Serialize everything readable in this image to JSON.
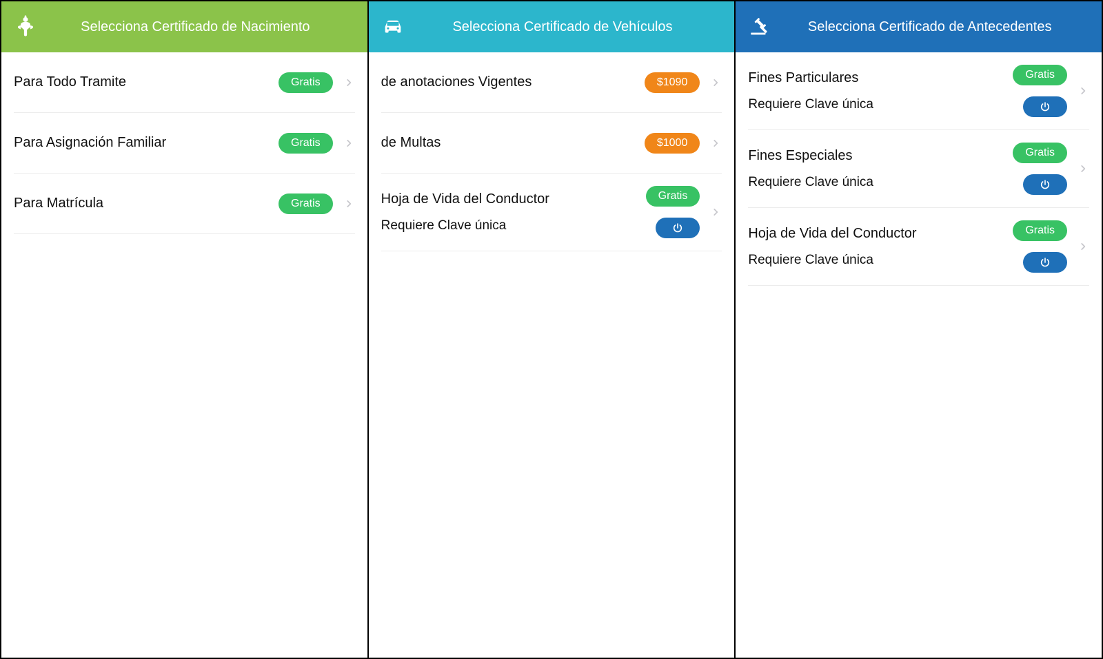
{
  "icons": {
    "baby": "baby-icon",
    "car": "car-icon",
    "gavel": "gavel-icon",
    "power": "power-icon",
    "chevron": "chevron-right-icon"
  },
  "colors": {
    "header_green": "#8BC34A",
    "header_cyan": "#2CB6CC",
    "header_blue": "#1F70B8",
    "pill_green": "#38C264",
    "pill_orange": "#F08619",
    "pill_blue": "#1F70B8"
  },
  "panels": [
    {
      "id": "nacimiento",
      "title": "Selecciona Certificado de Nacimiento",
      "items": [
        {
          "title": "Para Todo Tramite",
          "badge": "Gratis",
          "badge_style": "green"
        },
        {
          "title": "Para Asignación Familiar",
          "badge": "Gratis",
          "badge_style": "green"
        },
        {
          "title": "Para Matrícula",
          "badge": "Gratis",
          "badge_style": "green"
        }
      ]
    },
    {
      "id": "vehiculos",
      "title": "Selecciona Certificado de Vehículos",
      "items": [
        {
          "title": "de anotaciones Vigentes",
          "badge": "$1090",
          "badge_style": "orange"
        },
        {
          "title": "de Multas",
          "badge": "$1000",
          "badge_style": "orange"
        },
        {
          "title": "Hoja de Vida del Conductor",
          "subtitle": "Requiere Clave única",
          "badge": "Gratis",
          "badge_style": "green",
          "requires_key": true
        }
      ]
    },
    {
      "id": "antecedentes",
      "title": "Selecciona Certificado de Antecedentes",
      "items": [
        {
          "title": "Fines Particulares",
          "subtitle": "Requiere Clave única",
          "badge": "Gratis",
          "badge_style": "green",
          "requires_key": true
        },
        {
          "title": "Fines Especiales",
          "subtitle": "Requiere Clave única",
          "badge": "Gratis",
          "badge_style": "green",
          "requires_key": true
        },
        {
          "title": "Hoja de Vida del Conductor",
          "subtitle": "Requiere Clave única",
          "badge": "Gratis",
          "badge_style": "green",
          "requires_key": true
        }
      ]
    }
  ]
}
